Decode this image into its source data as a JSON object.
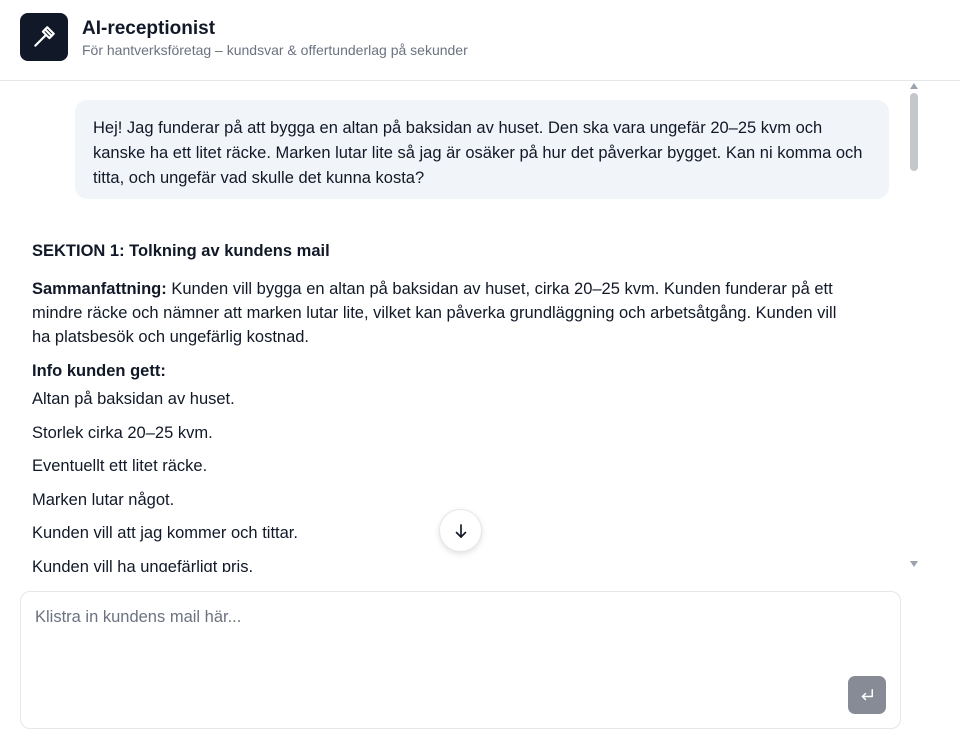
{
  "header": {
    "logo_icon": "hammer-icon",
    "title": "AI-receptionist",
    "subtitle": "För hantverksföretag – kundsvar & offertunderlag på sekunder"
  },
  "chat": {
    "user_message": "Hej! Jag funderar på att bygga en altan på baksidan av huset. Den ska vara ungefär 20–25 kvm och kanske ha ett litet räcke. Marken lutar lite så jag är osäker på hur det påverkar bygget. Kan ni komma och titta, och ungefär vad skulle det kunna kosta?",
    "assistant": {
      "section_heading": "SEKTION 1: Tolkning av kundens mail",
      "summary_label": "Sammanfattning:",
      "summary_text": " Kunden vill bygga en altan på baksidan av huset, cirka 20–25 kvm. Kunden funderar på ett mindre räcke och nämner att marken lutar lite, vilket kan påverka grundläggning och arbetsåtgång. Kunden vill ha platsbesök och ungefärlig kostnad.",
      "info_heading": "Info kunden gett:",
      "info_items": [
        "Altan på baksidan av huset.",
        "Storlek cirka 20–25 kvm.",
        "Eventuellt ett litet räcke.",
        "Marken lutar något.",
        "Kunden vill att jag kommer och tittar.",
        "Kunden vill ha ungefärligt pris."
      ]
    },
    "scroll_down_icon": "arrow-down-icon"
  },
  "composer": {
    "placeholder": "Klistra in kundens mail här...",
    "value": "",
    "send_icon": "enter-return-icon"
  },
  "colors": {
    "logo_bg": "#111827",
    "user_bubble_bg": "#f1f5f9",
    "send_button_bg": "#868b95",
    "subtitle_text": "#6b7280"
  }
}
